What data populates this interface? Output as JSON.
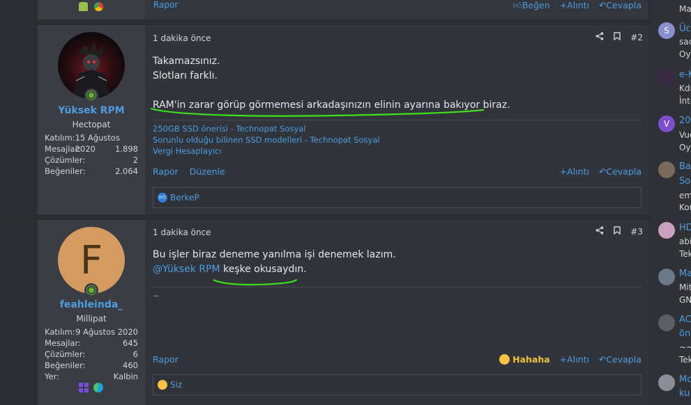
{
  "top_post": {
    "report_label": "Rapor",
    "like_label": "Beğen",
    "quote_label": "Alıntı",
    "reply_label": "Cevapla"
  },
  "posts": [
    {
      "time": "1 dakika önce",
      "number": "#2",
      "user": {
        "name": "Yüksek RPM",
        "title": "Hectopat",
        "stats": [
          {
            "k": "Katılım:",
            "v": "15 Ağustos 2020"
          },
          {
            "k": "Mesajlar:",
            "v": "1.898"
          },
          {
            "k": "Çözümler:",
            "v": "2"
          },
          {
            "k": "Beğeniler:",
            "v": "2.064"
          }
        ]
      },
      "lines": [
        "Takamazsınız.",
        "Slotları farklı.",
        "RAM'in zarar görüp görmemesi arkadaşınızın elinin ayarına bakıyor biraz."
      ],
      "signature": [
        "250GB SSD önerisi - Technopat Sosyal",
        "Sorunlu olduğu bilinen SSD modelleri - Technopat Sosyal",
        "Vergi Hesaplayıcı"
      ],
      "actions": {
        "report": "Rapor",
        "edit": "Düzenle",
        "quote": "Alıntı",
        "reply": "Cevapla"
      },
      "reactions": "BerkeP"
    },
    {
      "time": "1 dakika önce",
      "number": "#3",
      "user": {
        "name": "feahleinda_",
        "title": "Millipat",
        "avatar_letter": "F",
        "stats": [
          {
            "k": "Katılım:",
            "v": "9 Ağustos 2020"
          },
          {
            "k": "Mesajlar:",
            "v": "645"
          },
          {
            "k": "Çözümler:",
            "v": "6"
          },
          {
            "k": "Beğeniler:",
            "v": "460"
          },
          {
            "k": "Yer:",
            "v": "Kalbin"
          }
        ]
      },
      "line1": "Bu işler biraz deneme yanılma işi denemek lazım.",
      "mention": "@Yüksek RPM",
      "line2_rest": "keşke okusaydın.",
      "signature_mark": "~",
      "actions": {
        "report": "Rapor",
        "hahaha": "Hahaha",
        "quote": "Alıntı",
        "reply": "Cevapla"
      },
      "reactions": "Siz"
    }
  ],
  "sidebar": [
    {
      "l1": "Ma",
      "l2": ""
    },
    {
      "l1": "Üc",
      "l2": "sac",
      "l3": "Oy"
    },
    {
      "l1": "e-K",
      "l2": "Kdı",
      "l3": "İnte"
    },
    {
      "l1": "202",
      "l2": "Vuo",
      "l3": "Oy"
    },
    {
      "l1": "Ba",
      "l2": "So",
      "l3": "em",
      "l4": "Kor"
    },
    {
      "l1": "HD",
      "l2": "abi",
      "l3": "Tek"
    },
    {
      "l1": "Ma",
      "l2": "Mit",
      "l3": "GN"
    },
    {
      "l1": "AC",
      "l2": "ön",
      "l3": "~~",
      "l4": "Tek"
    },
    {
      "l1": "Mo",
      "l2": "ku"
    }
  ]
}
